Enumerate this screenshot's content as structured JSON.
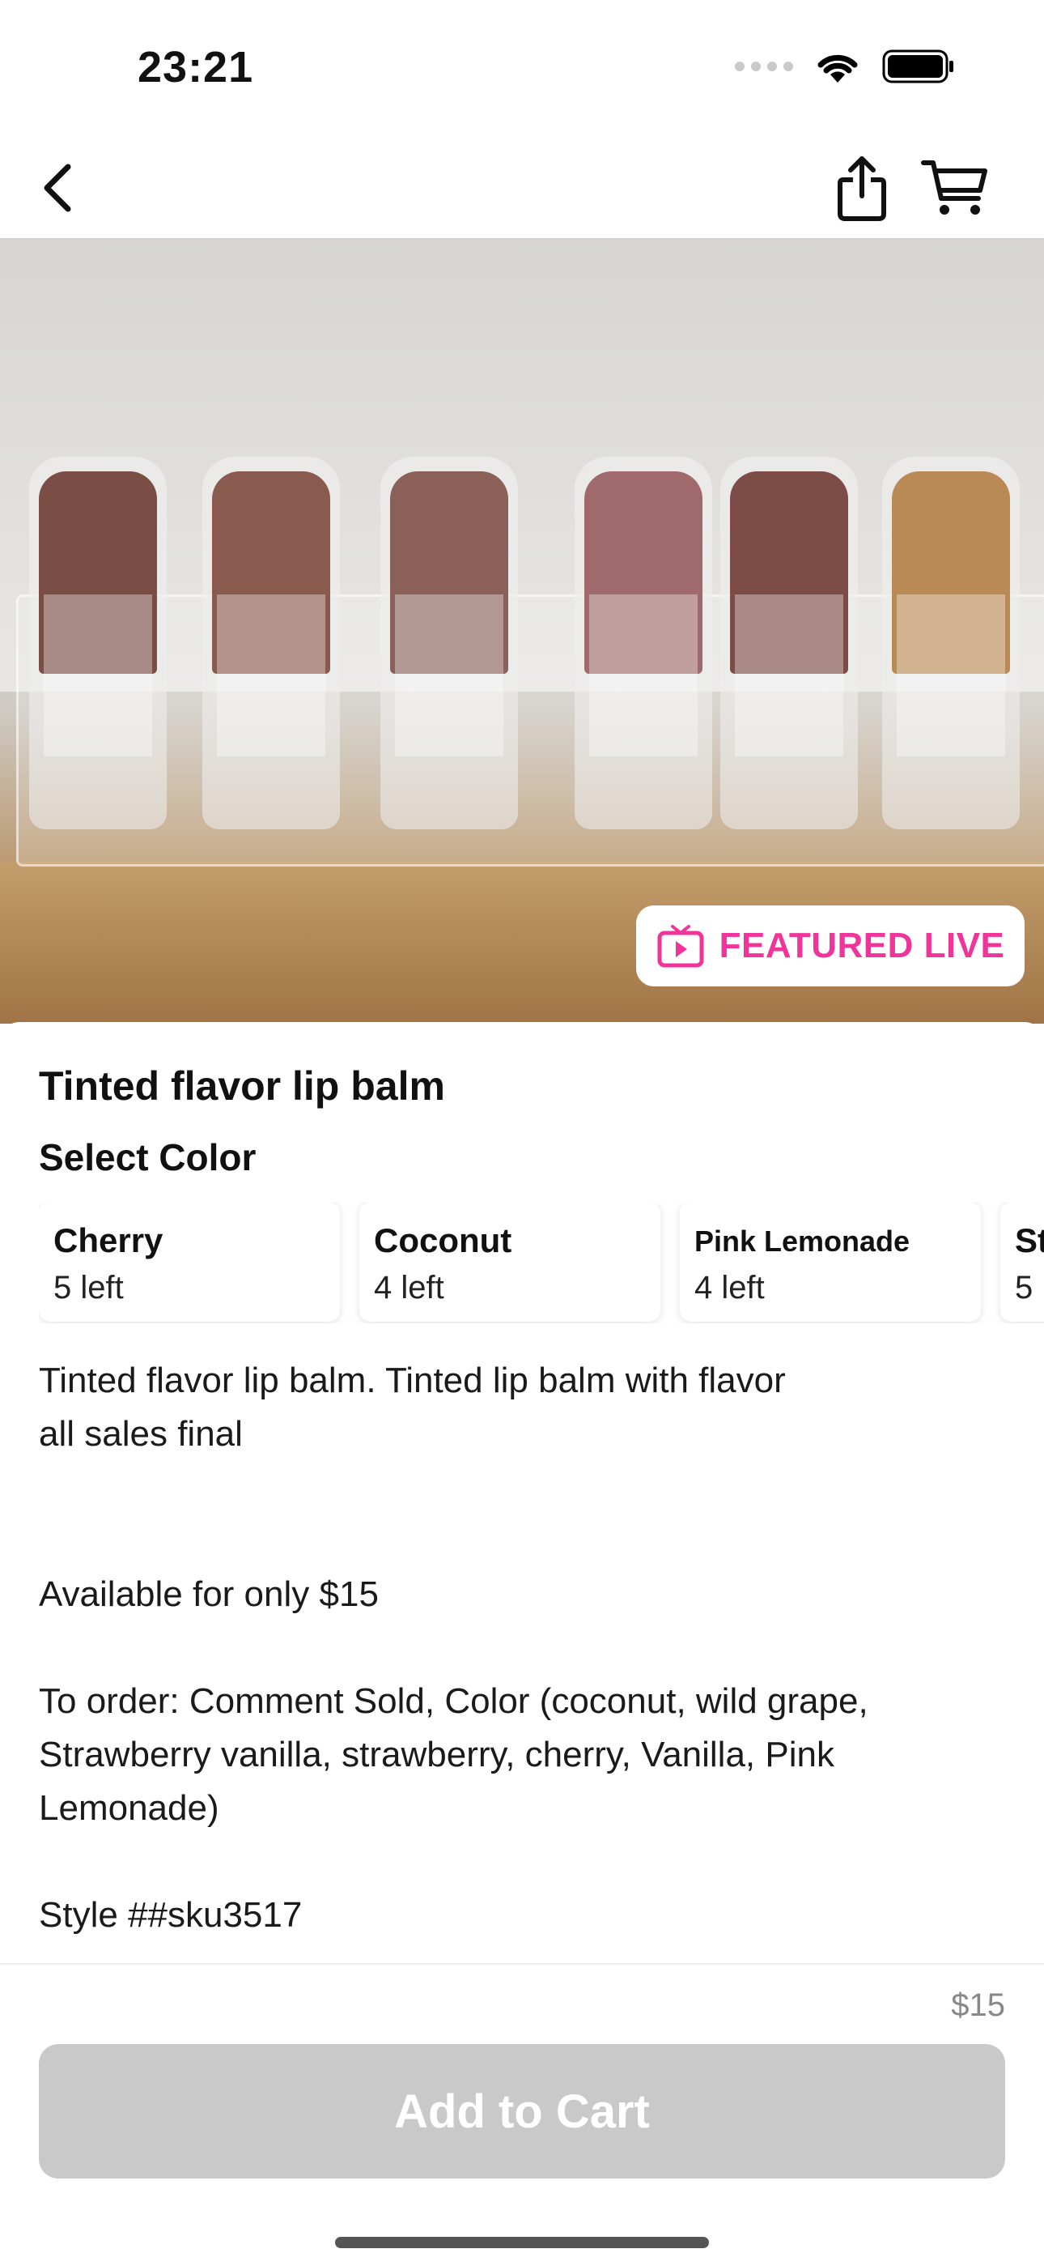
{
  "status_bar": {
    "time": "23:21"
  },
  "hero": {
    "badge_label": "FEATURED LIVE",
    "badge_color": "#f0359a"
  },
  "product": {
    "title": "Tinted flavor lip balm",
    "select_label": "Select Color",
    "variants": [
      {
        "name": "Cherry",
        "stock": "5 left"
      },
      {
        "name": "Coconut",
        "stock": "4 left"
      },
      {
        "name": "Pink Lemonade",
        "stock": "4 left"
      },
      {
        "name": "St",
        "stock": "5"
      }
    ],
    "description": {
      "line1": "Tinted flavor lip balm. Tinted  lip balm with flavor",
      "line2": "all sales final",
      "availability": "Available for only $15",
      "order_info": "To order: Comment Sold, Color (coconut, wild grape, Strawberry vanilla, strawberry, cherry, Vanilla, Pink Lemonade)",
      "style": "Style ##sku3517"
    }
  },
  "bottom": {
    "price": "$15",
    "add_to_cart": "Add to Cart"
  },
  "icons": {
    "back": "chevron-left-icon",
    "share": "share-icon",
    "cart": "cart-icon",
    "live": "tv-play-icon"
  }
}
